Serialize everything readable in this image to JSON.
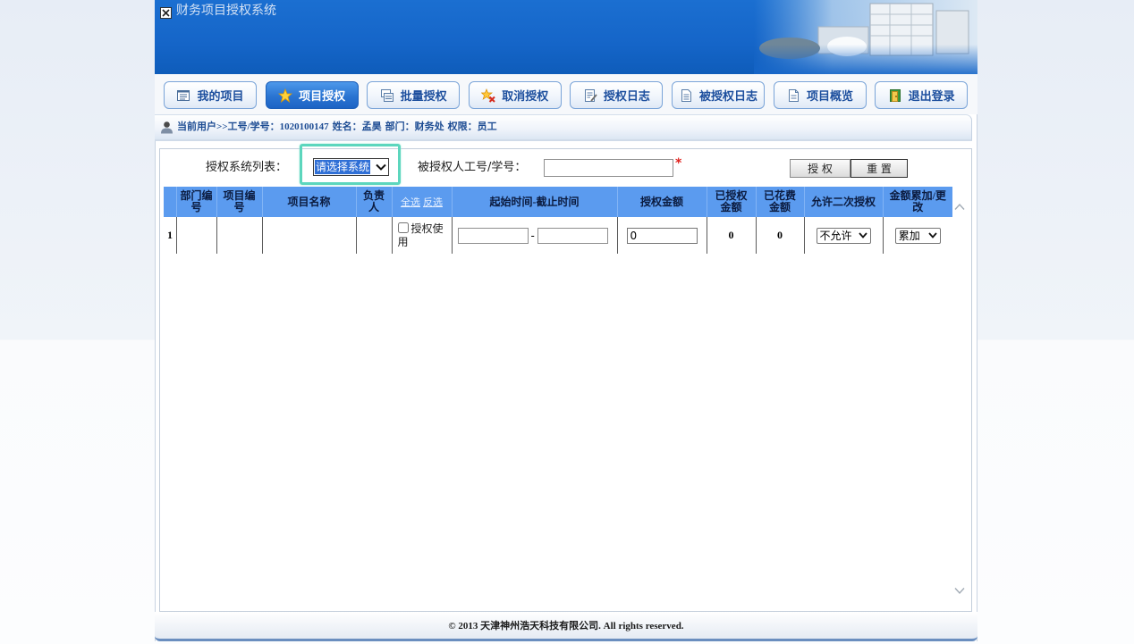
{
  "theme": {
    "header_blue": "#1565c8",
    "active_tab_blue": "#2a74d2",
    "tab_text": "#1d4f9e",
    "table_header_blue": "#5b9bef",
    "focus_highlight": "#5cd6bd",
    "required_red": "#e0201c",
    "selection_blue": "#2f6fd6"
  },
  "window": {
    "title": "财务项目授权系统"
  },
  "nav": {
    "tabs": [
      {
        "label": "我的项目",
        "icon": "list-icon"
      },
      {
        "label": "项目授权",
        "icon": "star-icon",
        "active": true
      },
      {
        "label": "批量授权",
        "icon": "batch-icon"
      },
      {
        "label": "取消授权",
        "icon": "cancel-auth-icon"
      },
      {
        "label": "授权日志",
        "icon": "log-icon"
      },
      {
        "label": "被授权日志",
        "icon": "document-icon"
      },
      {
        "label": "项目概览",
        "icon": "overview-icon"
      },
      {
        "label": "退出登录",
        "icon": "logout-icon"
      }
    ]
  },
  "user_info": {
    "prefix": "当前用户>>",
    "id_label": "工号/学号：",
    "id_value": "1020100147",
    "name_label": "姓名：",
    "name_value": "孟昊",
    "dept_label": "部门：",
    "dept_value": "财务处",
    "role_label": "权限：",
    "role_value": "员工"
  },
  "form": {
    "system_label": "授权系统列表：",
    "system_select": {
      "value": "请选择系统"
    },
    "grantee_label": "被授权人工号/学号：",
    "grantee_input": {
      "value": ""
    },
    "required_mark": "*",
    "authorize_button": "授 权",
    "reset_button": "重 置"
  },
  "table": {
    "headers": {
      "dept_no": "部门编号",
      "project_no": "项目编号",
      "project_name": "项目名称",
      "owner": "负责人",
      "select_all": "全选",
      "invert_select": "反选",
      "period": "起始时间-截止时间",
      "amount": "授权金额",
      "authorized_amount": "已授权金额",
      "spent_amount": "已花费金额",
      "allow_second_grant": "允许二次授权",
      "amount_mode": "金额累加/更改"
    },
    "rows": [
      {
        "index": "1",
        "authorize_use": {
          "label": "授权使用",
          "checked": false
        },
        "start_time": "",
        "period_separator": "-",
        "end_time": "",
        "amount": "0",
        "authorized_amount": "0",
        "spent_amount": "0",
        "allow_second_grant": "不允许",
        "amount_mode": "累加"
      }
    ]
  },
  "footer": {
    "text": "© 2013 天津神州浩天科技有限公司. All rights reserved."
  }
}
